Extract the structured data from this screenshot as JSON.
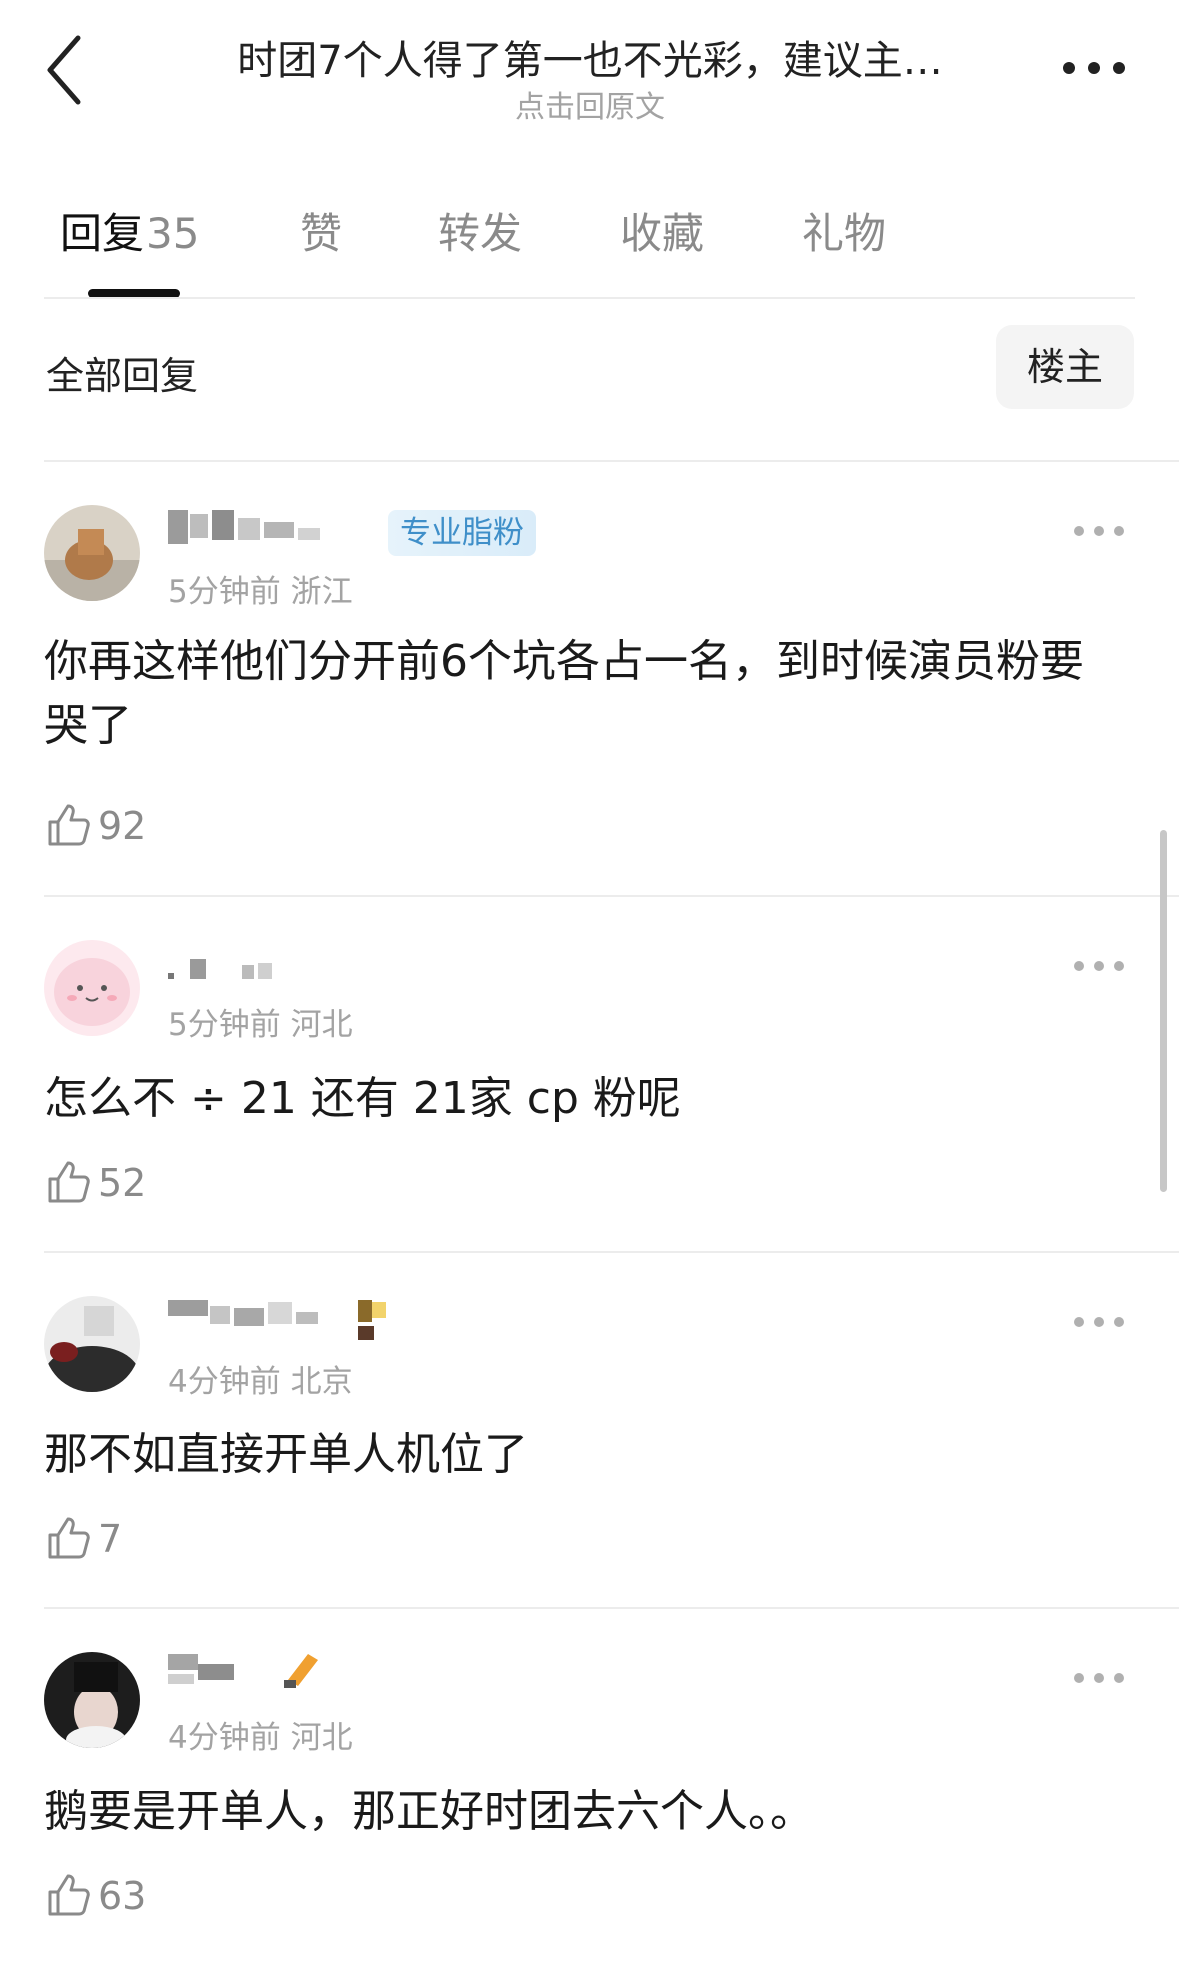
{
  "header": {
    "title": "时团7个人得了第一也不光彩，建议主…",
    "subtitle": "点击回原文"
  },
  "tabs": [
    {
      "label": "回复",
      "count": "35"
    },
    {
      "label": "赞"
    },
    {
      "label": "转发"
    },
    {
      "label": "收藏"
    },
    {
      "label": "礼物"
    }
  ],
  "filter": {
    "label": "全部回复",
    "owner_button": "楼主"
  },
  "comments": [
    {
      "badge": "专业脂粉",
      "meta": "5分钟前 浙江",
      "text": "你再这样他们分开前6个坑各占一名，到时候演员粉要哭了",
      "likes": "92"
    },
    {
      "meta": "5分钟前 河北",
      "text": "怎么不 ÷ 21 还有 21家 cp 粉呢",
      "likes": "52"
    },
    {
      "meta": "4分钟前 北京",
      "text": "那不如直接开单人机位了",
      "likes": "7"
    },
    {
      "meta": "4分钟前 河北",
      "text": "鹅要是开单人，那正好时团去六个人。。",
      "likes": "63"
    }
  ],
  "colors": {
    "text_primary": "#1a1a1a",
    "text_secondary": "#a3a3a3",
    "badge_blue": "#3f8fc9",
    "divider": "#ececec"
  }
}
